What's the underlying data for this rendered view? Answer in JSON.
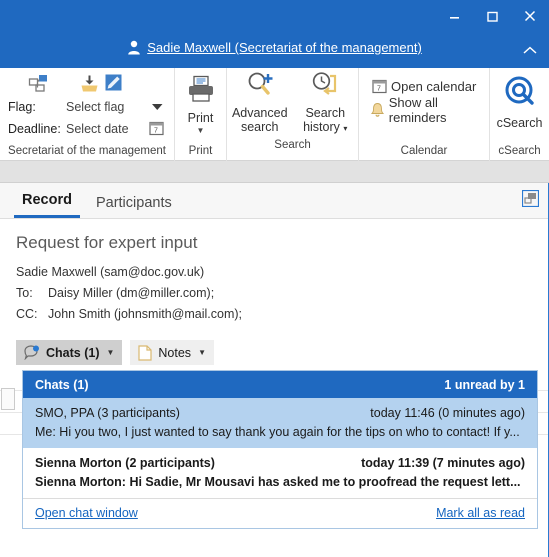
{
  "titlebar": {
    "user_link": "Sadie Maxwell (Secretariat of the management)",
    "minimize_label": "Minimize",
    "maximize_label": "Maximize",
    "close_label": "Close",
    "collapse_label": "Collapse ribbon",
    "accent_color": "#1f69c0"
  },
  "ribbon": {
    "flag_group": {
      "flag_label": "Flag:",
      "flag_value": "Select flag",
      "deadline_label": "Deadline:",
      "deadline_value": "Select date",
      "group_label": "Secretariat of the management"
    },
    "print_group": {
      "button_label": "Print",
      "group_label": "Print"
    },
    "search_group": {
      "advanced_search_label": "Advanced\nsearch",
      "advanced_search_line1": "Advanced",
      "advanced_search_line2": "search",
      "search_history_line1": "Search",
      "search_history_line2": "history",
      "group_label": "Search"
    },
    "calendar_group": {
      "open_calendar": "Open calendar",
      "show_all_reminders": "Show all reminders",
      "group_label": "Calendar"
    },
    "csearch_group": {
      "button_label": "cSearch",
      "group_label": "cSearch"
    }
  },
  "content": {
    "tabs": [
      {
        "label": "Record",
        "active": true
      },
      {
        "label": "Participants",
        "active": false
      }
    ],
    "subject": "Request for expert input",
    "from": "Sadie Maxwell (sam@doc.gov.uk)",
    "to_label": "To:",
    "to_value": "Daisy Miller (dm@miller.com);",
    "cc_label": "CC:",
    "cc_value": "John Smith (johnsmith@mail.com);",
    "chats_button": "Chats (1)",
    "notes_button": "Notes"
  },
  "chat_popup": {
    "header_title": "Chats (1)",
    "header_status": "1 unread by 1",
    "rows": [
      {
        "participants": "SMO, PPA (3 participants)",
        "time": "today 11:46 (0 minutes ago)",
        "preview": "Me: Hi you two, I just wanted to say thank you again for the tips on who to contact! If y...",
        "state": "selected"
      },
      {
        "participants": "Sienna Morton (2 participants)",
        "time": "today 11:39 (7 minutes ago)",
        "preview": "Sienna Morton: Hi Sadie,  Mr Mousavi has asked me to proofread the request lett...",
        "state": "unread"
      }
    ],
    "open_chat_window": "Open chat window",
    "mark_all_as_read": "Mark all as read"
  }
}
